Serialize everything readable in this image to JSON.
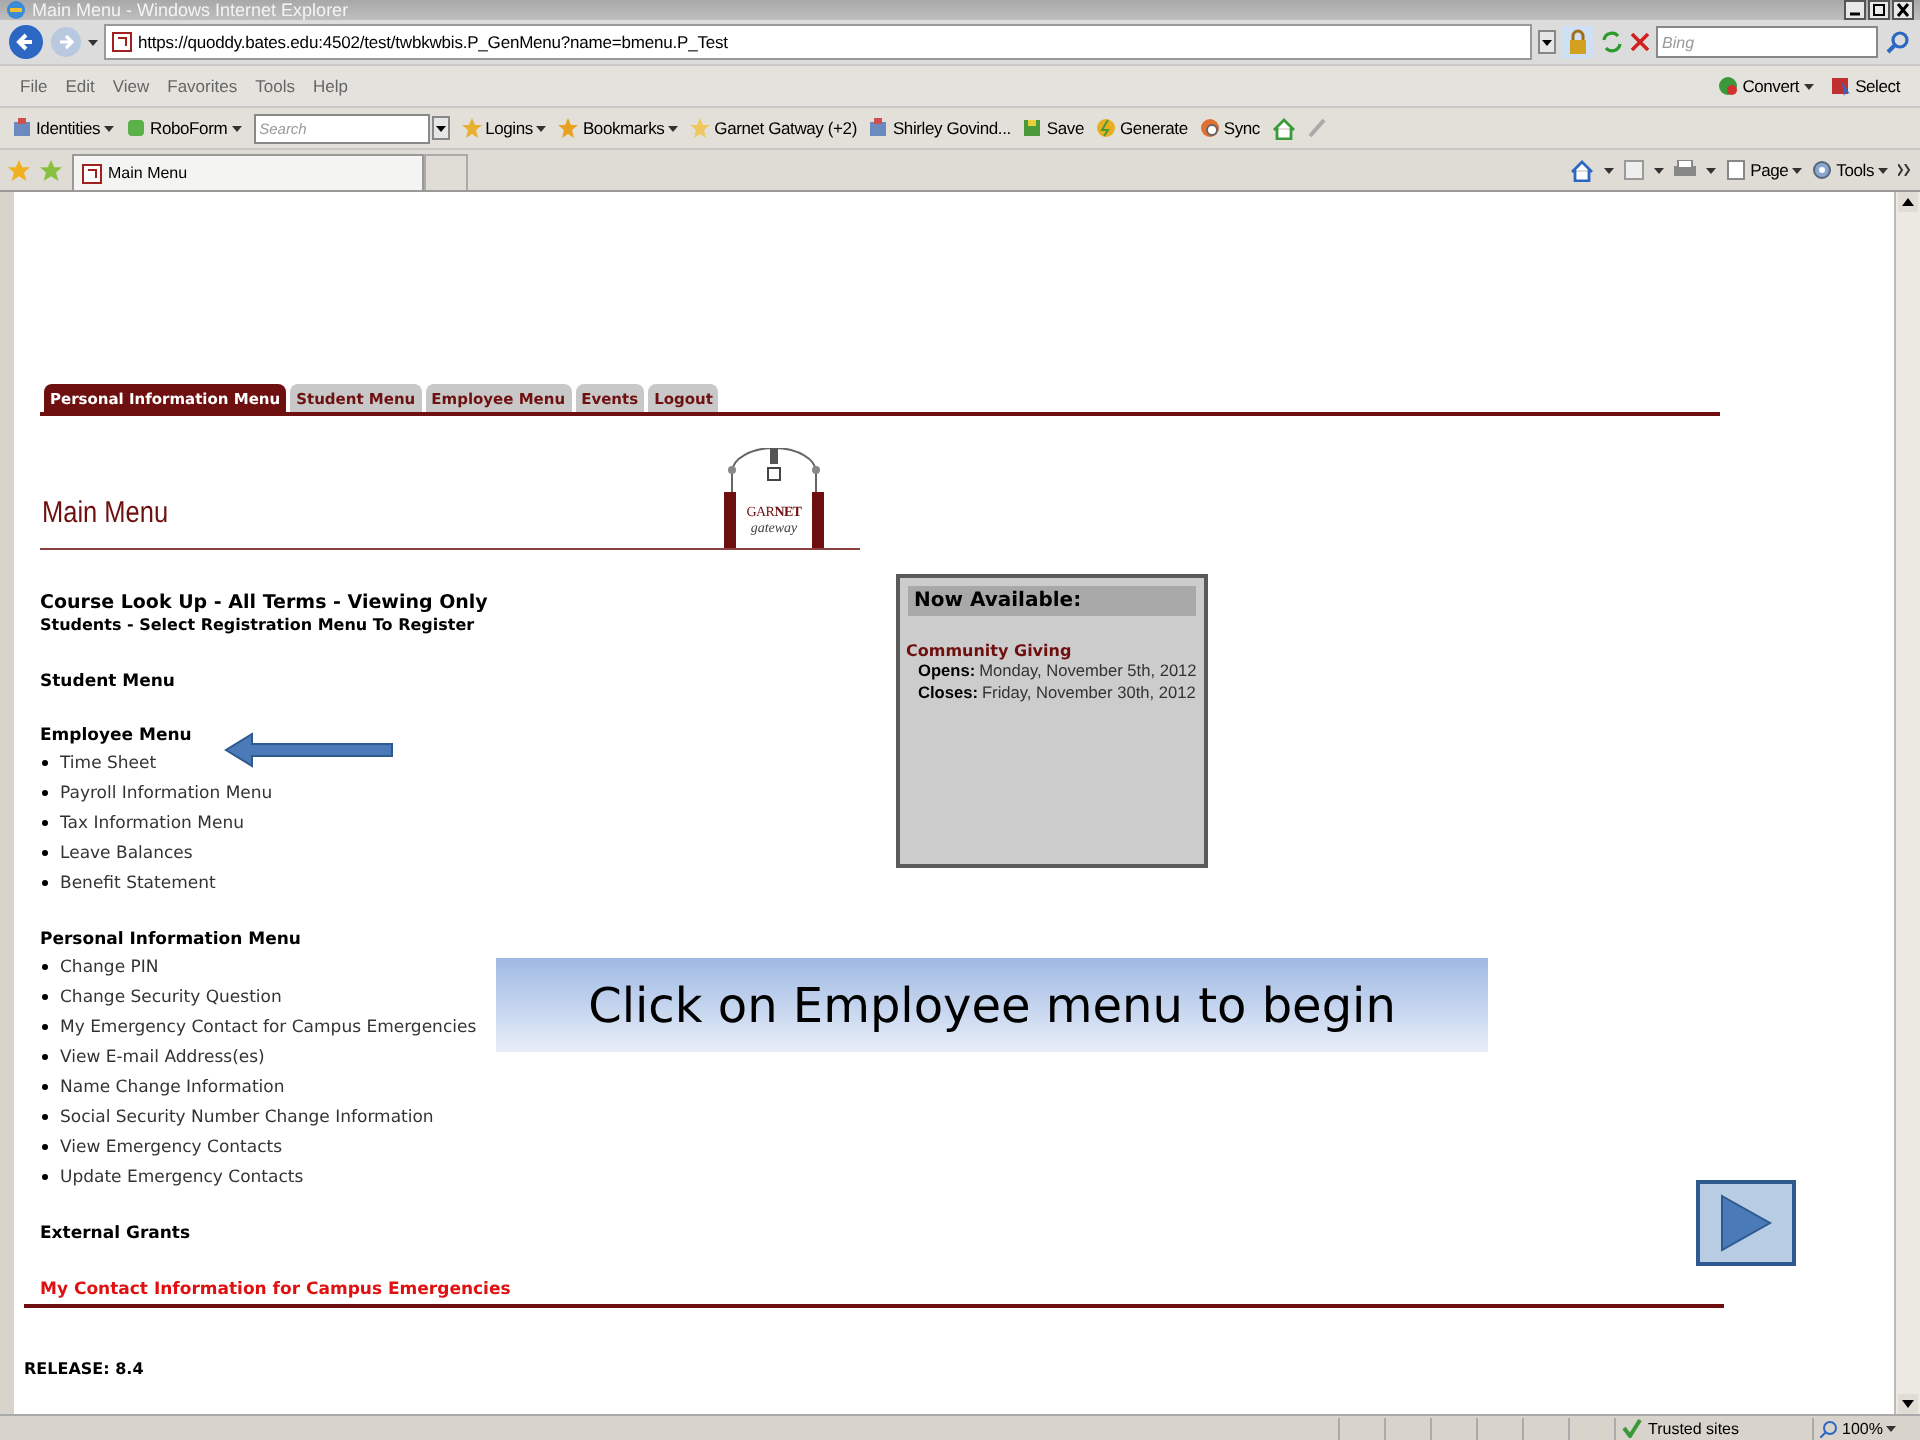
{
  "window": {
    "title": "Main Menu - Windows Internet Explorer"
  },
  "address_bar": {
    "url": "https://quoddy.bates.edu:4502/test/twbkwbis.P_GenMenu?name=bmenu.P_Test",
    "search_placeholder": "Bing"
  },
  "menu_bar": [
    "File",
    "Edit",
    "View",
    "Favorites",
    "Tools",
    "Help"
  ],
  "menu_bar_right": [
    {
      "label": "Convert",
      "dropdown": true
    },
    {
      "label": "Select",
      "dropdown": false
    }
  ],
  "links_toolbar": [
    {
      "kind": "item",
      "label": "Identities",
      "dropdown": true
    },
    {
      "kind": "item",
      "label": "RoboForm",
      "dropdown": true
    },
    {
      "kind": "search",
      "placeholder": "Search"
    },
    {
      "kind": "item",
      "label": "Logins",
      "dropdown": true
    },
    {
      "kind": "item",
      "label": "Bookmarks",
      "dropdown": true
    },
    {
      "kind": "item",
      "label": "Garnet Gatway (+2)",
      "dropdown": false
    },
    {
      "kind": "item",
      "label": "Shirley Govind...",
      "dropdown": false
    },
    {
      "kind": "item",
      "label": "Save",
      "dropdown": false
    },
    {
      "kind": "item",
      "label": "Generate",
      "dropdown": false
    },
    {
      "kind": "item",
      "label": "Sync",
      "dropdown": false
    }
  ],
  "browser_tab": {
    "title": "Main Menu"
  },
  "command_bar": [
    "Page",
    "Tools"
  ],
  "page": {
    "nav_tabs": [
      {
        "label": "Personal Information Menu",
        "selected": true
      },
      {
        "label": "Student Menu",
        "selected": false
      },
      {
        "label": "Employee Menu",
        "selected": false
      },
      {
        "label": "Events",
        "selected": false
      },
      {
        "label": "Logout",
        "selected": false
      }
    ],
    "heading": "Main Menu",
    "logo": {
      "name": "GAR**NET**",
      "tagline": "gateway"
    },
    "notices": [
      "Course Look Up - All Terms - Viewing Only",
      "Students - Select Registration Menu To Register"
    ],
    "sections": [
      {
        "title": "Student Menu"
      },
      {
        "title": "Employee Menu",
        "items": [
          "Time Sheet",
          "Payroll Information Menu",
          "Tax Information Menu",
          "Leave Balances",
          "Benefit Statement"
        ]
      },
      {
        "title": "Personal Information Menu",
        "items": [
          "Change PIN",
          "Change Security Question",
          "My Emergency Contact for Campus Emergencies",
          "View E-mail Address(es)",
          "Name Change Information",
          "Social Security Number Change Information",
          "View Emergency Contacts",
          "Update Emergency Contacts"
        ]
      },
      {
        "title": "External Grants"
      }
    ],
    "footer_link": "My Contact Information for Campus Emergencies",
    "release": "RELEASE: 8.4",
    "side_box": {
      "title": "Now Available:",
      "event": "Community Giving",
      "rows": [
        {
          "label": "Opens:",
          "value": "Monday, November 5th, 2012"
        },
        {
          "label": "Closes:",
          "value": "Friday, November 30th, 2012"
        }
      ]
    }
  },
  "callout": {
    "text": "Click on Employee menu to begin"
  },
  "status_bar": {
    "zone": "Trusted sites",
    "zoom": "100%"
  }
}
